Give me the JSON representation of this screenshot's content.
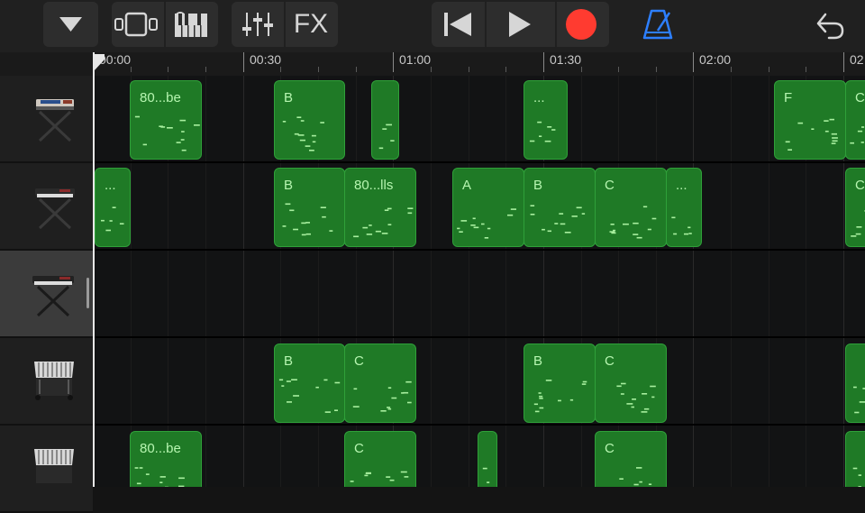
{
  "toolbar": {
    "fx_label": "FX",
    "record_color": "#ff3b30",
    "metronome_color": "#2d7fff",
    "icons": [
      "dropdown-triangle-icon",
      "track-view-icon",
      "instrument-keyboard-icon",
      "mixer-sliders-icon",
      "fx",
      "rewind-icon",
      "play-icon",
      "record-icon",
      "metronome-icon",
      "undo-icon"
    ]
  },
  "ruler": {
    "labels": [
      "00:00",
      "00:30",
      "01:00",
      "01:30",
      "02:00",
      "02"
    ]
  },
  "tracks": [
    {
      "name": "keyboard-synth-1",
      "icon": "keyboard-stand-icon",
      "selected": false
    },
    {
      "name": "keyboard-synth-2",
      "icon": "keyboard-stand-icon",
      "selected": false
    },
    {
      "name": "keyboard-synth-3",
      "icon": "keyboard-stand-icon",
      "selected": true
    },
    {
      "name": "vibraphone-1",
      "icon": "vibraphone-icon",
      "selected": false
    },
    {
      "name": "vibraphone-2",
      "icon": "vibraphone-icon",
      "selected": false
    }
  ],
  "regions": [
    {
      "track": 0,
      "label": "80...be"
    },
    {
      "track": 0,
      "label": "B"
    },
    {
      "track": 0,
      "label": ""
    },
    {
      "track": 0,
      "label": "..."
    },
    {
      "track": 0,
      "label": "F"
    },
    {
      "track": 0,
      "label": "C"
    },
    {
      "track": 1,
      "label": "..."
    },
    {
      "track": 1,
      "label": "B"
    },
    {
      "track": 1,
      "label": "80...lls"
    },
    {
      "track": 1,
      "label": "A"
    },
    {
      "track": 1,
      "label": "B"
    },
    {
      "track": 1,
      "label": "C"
    },
    {
      "track": 1,
      "label": "..."
    },
    {
      "track": 1,
      "label": "C"
    },
    {
      "track": 3,
      "label": "B"
    },
    {
      "track": 3,
      "label": "C"
    },
    {
      "track": 3,
      "label": "B"
    },
    {
      "track": 3,
      "label": "C"
    },
    {
      "track": 3,
      "label": ""
    },
    {
      "track": 4,
      "label": "80...be"
    },
    {
      "track": 4,
      "label": "C"
    },
    {
      "track": 4,
      "label": ""
    },
    {
      "track": 4,
      "label": "C"
    },
    {
      "track": 4,
      "label": ""
    }
  ]
}
